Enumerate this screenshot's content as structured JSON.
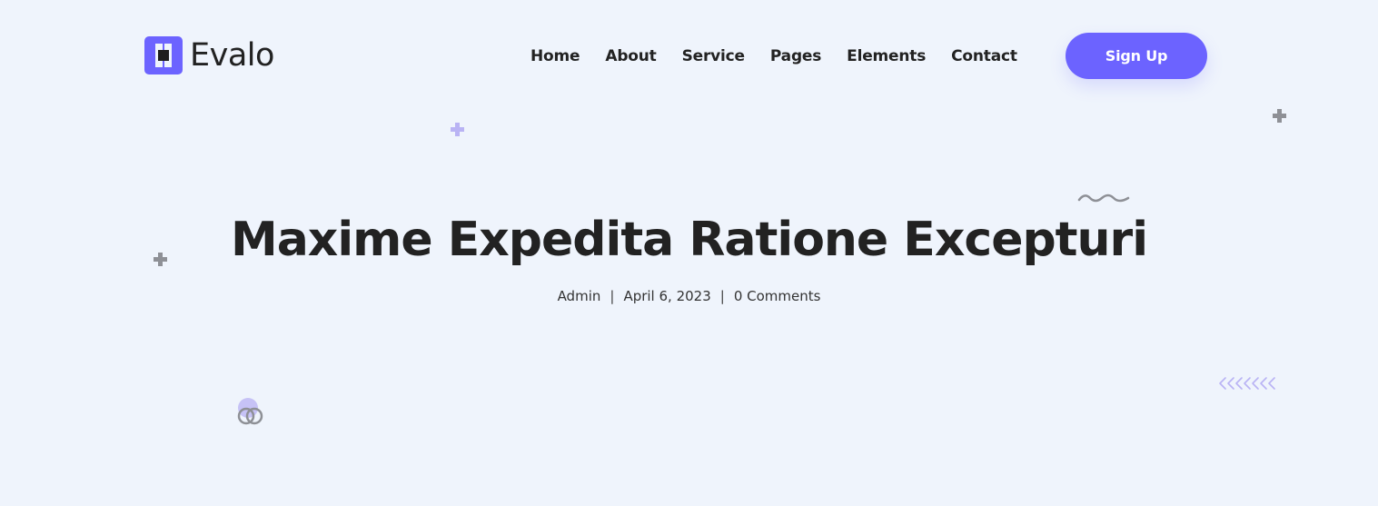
{
  "brand": {
    "name": "Evalo",
    "accent_color": "#6c63ff"
  },
  "nav": {
    "items": [
      {
        "label": "Home"
      },
      {
        "label": "About"
      },
      {
        "label": "Service"
      },
      {
        "label": "Pages"
      },
      {
        "label": "Elements"
      },
      {
        "label": "Contact"
      }
    ],
    "signup_label": "Sign Up"
  },
  "post": {
    "title": "Maxime Expedita Ratione Excepturi",
    "author": "Admin",
    "date": "April 6, 2023",
    "comments": "0 Comments"
  },
  "colors": {
    "background": "#eff4fc",
    "text": "#222222",
    "accent": "#6c63ff"
  }
}
